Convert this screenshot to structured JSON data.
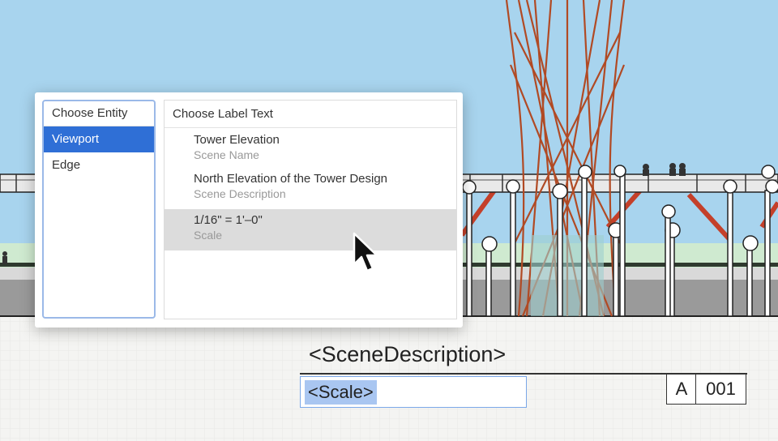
{
  "entity_panel": {
    "header": "Choose Entity",
    "items": [
      "Viewport",
      "Edge"
    ],
    "selected": "Viewport"
  },
  "label_panel": {
    "header": "Choose Label Text",
    "options": [
      {
        "value": "Tower Elevation",
        "kind": "Scene Name"
      },
      {
        "value": "North Elevation of the Tower Design",
        "kind": "Scene Description"
      },
      {
        "value": "1/16\" = 1'–0\"",
        "kind": "Scale"
      }
    ],
    "hovered": "Scale"
  },
  "title_block": {
    "scene_description": "<SceneDescription>",
    "scale_field": "<Scale>",
    "sheet_letter": "A",
    "sheet_number": "001"
  },
  "colors": {
    "accent": "#2f6fd6",
    "selection_highlight": "#a9c6f1",
    "sky": "#a8d4ee",
    "tower_orange": "#c4552a"
  },
  "icons": [
    "mouse-pointer-icon"
  ]
}
